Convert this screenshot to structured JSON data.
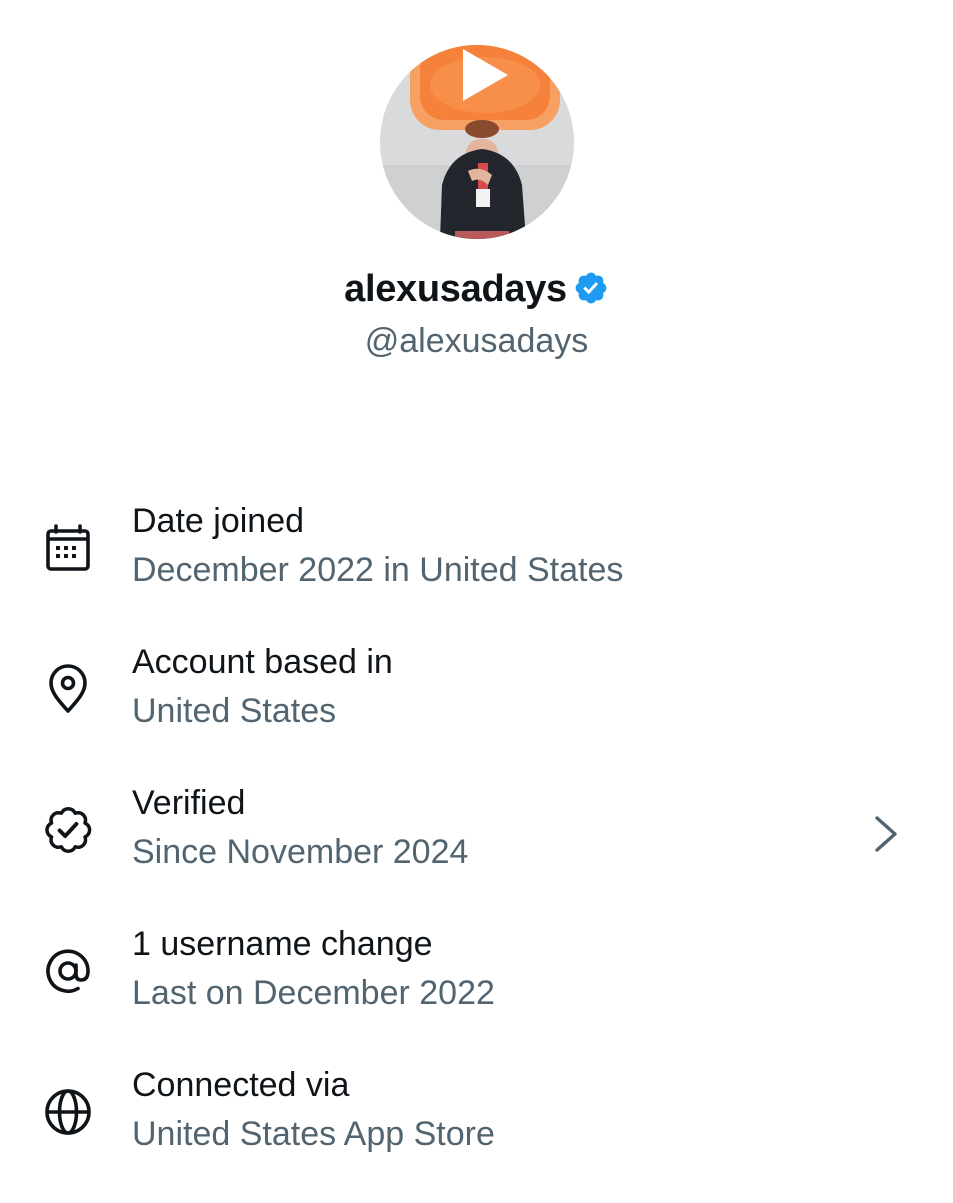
{
  "profile": {
    "display_name": "alexusadays",
    "handle": "@alexusadays",
    "verified": true,
    "avatar_icon": "avatar-photo"
  },
  "colors": {
    "verified_blue": "#1d9bf0",
    "text_primary": "#0f1419",
    "text_secondary": "#536471",
    "avatar_accent": "#f5813a"
  },
  "info_items": [
    {
      "icon": "calendar-icon",
      "title": "Date joined",
      "subtitle": "December 2022 in United States"
    },
    {
      "icon": "location-pin-icon",
      "title": "Account based in",
      "subtitle": "United States"
    },
    {
      "icon": "verified-badge-icon",
      "title": "Verified",
      "subtitle": "Since November 2024",
      "has_chevron": true
    },
    {
      "icon": "at-sign-icon",
      "title": "1 username change",
      "subtitle": "Last on December 2022"
    },
    {
      "icon": "globe-icon",
      "title": "Connected via",
      "subtitle": "United States App Store"
    }
  ]
}
